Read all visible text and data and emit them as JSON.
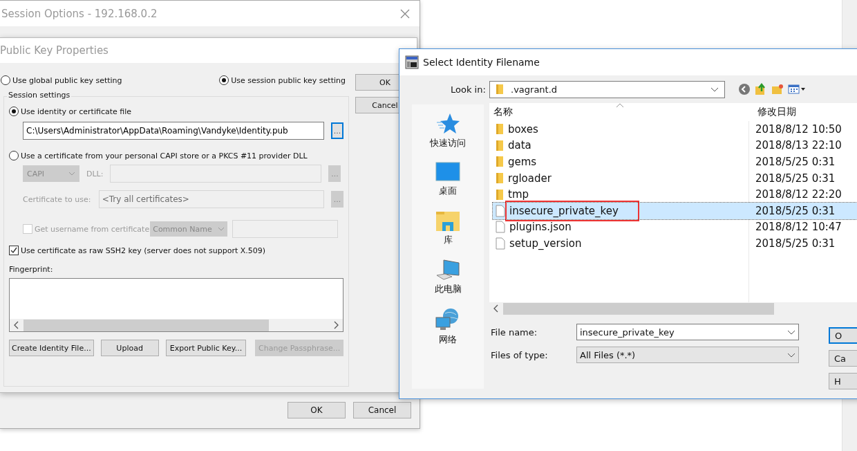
{
  "session_window": {
    "title": "Session Options - 192.168.0.2",
    "buttons": [
      "OK",
      "Cancel"
    ]
  },
  "pubkey_dialog": {
    "title": "Public Key Properties",
    "scope_options": [
      {
        "label": "Use global public key setting",
        "selected": false
      },
      {
        "label": "Use session public key setting",
        "selected": true
      }
    ],
    "side_buttons": [
      "OK",
      "Cancel"
    ],
    "group_label": "Session settings",
    "source_options": [
      {
        "label": "Use identity or certificate file",
        "selected": true
      },
      {
        "label": "Use a certificate from your personal CAPI store or a PKCS #11 provider DLL",
        "selected": false
      }
    ],
    "identity_path": "C:\\Users\\Administrator\\AppData\\Roaming\\Vandyke\\Identity.pub",
    "identity_browse": "...",
    "certificate_section": {
      "disabled": true,
      "provider": "CAPI",
      "dll_label": "DLL:",
      "dll_browse": "...",
      "cert_label": "Certificate to use:",
      "cert_value": "<Try all certificates>",
      "cert_browse": "...",
      "username_check": {
        "label": "Get username from certificate",
        "checked": false
      },
      "username_source": "Common Name"
    },
    "raw_key_check": {
      "label": "Use certificate as raw SSH2 key (server does not support X.509)",
      "checked": true
    },
    "fingerprint_label": "Fingerprint:",
    "action_buttons": [
      {
        "label": "Create Identity File...",
        "disabled": false
      },
      {
        "label": "Upload",
        "disabled": false
      },
      {
        "label": "Export Public Key...",
        "disabled": false
      },
      {
        "label": "Change Passphrase...",
        "disabled": true
      }
    ]
  },
  "file_dialog": {
    "title": "Select Identity Filename",
    "look_in_label": "Look in:",
    "look_in_value": ".vagrant.d",
    "places": [
      {
        "label": "快速访问",
        "kind": "quick"
      },
      {
        "label": "桌面",
        "kind": "desktop"
      },
      {
        "label": "库",
        "kind": "library"
      },
      {
        "label": "此电脑",
        "kind": "computer"
      },
      {
        "label": "网络",
        "kind": "network"
      }
    ],
    "columns": [
      "名称",
      "修改日期"
    ],
    "files": [
      {
        "name": "boxes",
        "date": "2018/8/12 10:50",
        "kind": "folder",
        "selected": false,
        "annotated": false
      },
      {
        "name": "data",
        "date": "2018/8/13 22:10",
        "kind": "folder",
        "selected": false,
        "annotated": false
      },
      {
        "name": "gems",
        "date": "2018/5/25 0:31",
        "kind": "folder",
        "selected": false,
        "annotated": false
      },
      {
        "name": "rgloader",
        "date": "2018/5/25 0:31",
        "kind": "folder",
        "selected": false,
        "annotated": false
      },
      {
        "name": "tmp",
        "date": "2018/8/12 22:20",
        "kind": "folder",
        "selected": false,
        "annotated": false
      },
      {
        "name": "insecure_private_key",
        "date": "2018/5/25 0:31",
        "kind": "file",
        "selected": true,
        "annotated": true
      },
      {
        "name": "plugins.json",
        "date": "2018/8/12 10:47",
        "kind": "file",
        "selected": false,
        "annotated": false
      },
      {
        "name": "setup_version",
        "date": "2018/5/25 0:31",
        "kind": "file",
        "selected": false,
        "annotated": false
      }
    ],
    "file_name_label": "File name:",
    "file_name_value": "insecure_private_key",
    "file_type_label": "Files of type:",
    "file_type_value": "All Files (*.*)",
    "buttons": [
      "O",
      "Ca",
      "H"
    ]
  }
}
